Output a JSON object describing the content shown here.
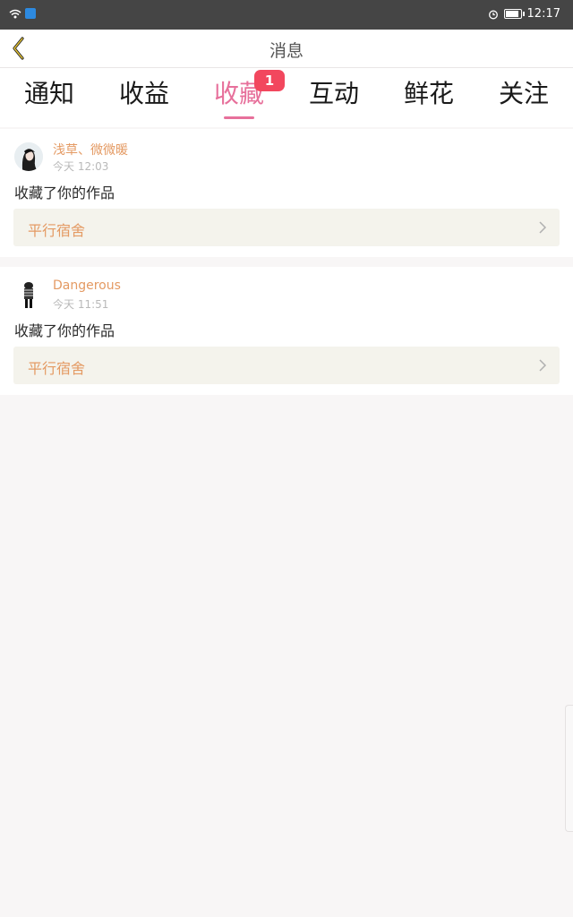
{
  "status_bar": {
    "time": "12:17",
    "icons": [
      "wifi-icon",
      "app-notification-icon",
      "alarm-icon",
      "battery-icon"
    ],
    "battery_level": 1.0
  },
  "header": {
    "title": "消息",
    "back_icon": "chevron-left-icon"
  },
  "tabs": [
    {
      "label": "通知",
      "active": false
    },
    {
      "label": "收益",
      "active": false
    },
    {
      "label": "收藏",
      "active": true,
      "badge": "1"
    },
    {
      "label": "互动",
      "active": false
    },
    {
      "label": "鲜花",
      "active": false
    },
    {
      "label": "关注",
      "active": false
    }
  ],
  "messages": [
    {
      "username": "浅草、微微暖",
      "time": "今天 12:03",
      "action": "收藏了你的作品",
      "work_title": "平行宿舍",
      "avatar_icon": "user-avatar"
    },
    {
      "username": "Dangerous",
      "time": "今天 11:51",
      "action": "收藏了你的作品",
      "work_title": "平行宿舍",
      "avatar_icon": "user-avatar"
    }
  ],
  "colors": {
    "accent_pink": "#e7709b",
    "badge_red": "#f2475e",
    "username_orange": "#e49a63",
    "status_bar": "#454545"
  }
}
